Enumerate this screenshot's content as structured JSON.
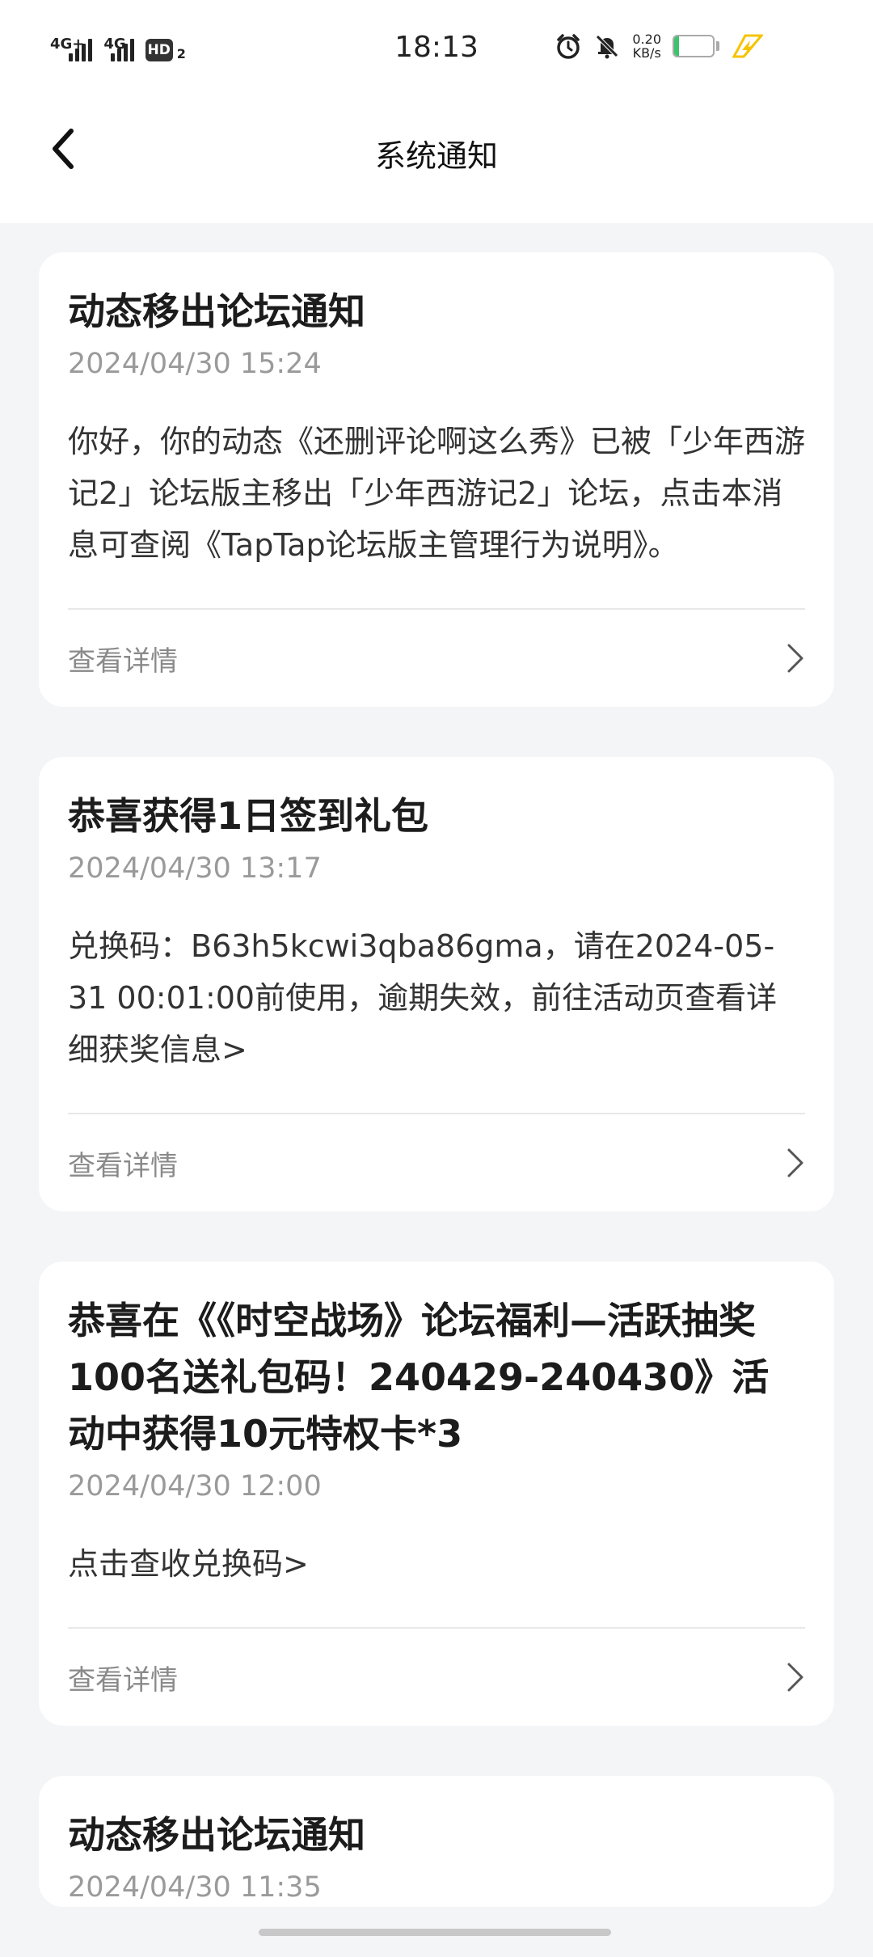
{
  "status_bar": {
    "network1": "4G+",
    "network2": "4G",
    "hd_label": "HD",
    "hd_sub": "2",
    "time": "18:13",
    "speed_value": "0.20",
    "speed_unit": "KB/s",
    "battery_level": "13",
    "icons": [
      "alarm-icon",
      "mute-icon",
      "charging-icon"
    ]
  },
  "header": {
    "title": "系统通知",
    "back_icon": "chevron-left-icon"
  },
  "notifications": [
    {
      "title": "动态移出论坛通知",
      "time": "2024/04/30 15:24",
      "body": "你好，你的动态《还删评论啊这么秀》已被「少年西游记2」论坛版主移出「少年西游记2」论坛，点击本消息可查阅《TapTap论坛版主管理行为说明》。",
      "detail_label": "查看详情"
    },
    {
      "title": "恭喜获得1日签到礼包",
      "time": "2024/04/30 13:17",
      "body": "兑换码：B63h5kcwi3qba86gma，请在2024-05-31 00:01:00前使用，逾期失效，前往活动页查看详细获奖信息>",
      "detail_label": "查看详情"
    },
    {
      "title": "恭喜在《《时空战场》论坛福利—活跃抽奖100名送礼包码！240429-240430》活动中获得10元特权卡*3",
      "time": "2024/04/30 12:00",
      "body": "点击查收兑换码>",
      "detail_label": "查看详情"
    },
    {
      "title": "动态移出论坛通知",
      "time": "2024/04/30 11:35",
      "body": "",
      "detail_label": ""
    }
  ],
  "colors": {
    "page_bg": "#f4f5f7",
    "card_bg": "#ffffff",
    "title_text": "#1c1c1c",
    "time_text": "#9a9a9a",
    "battery": "#3cc36b",
    "charging": "#f5c400"
  }
}
